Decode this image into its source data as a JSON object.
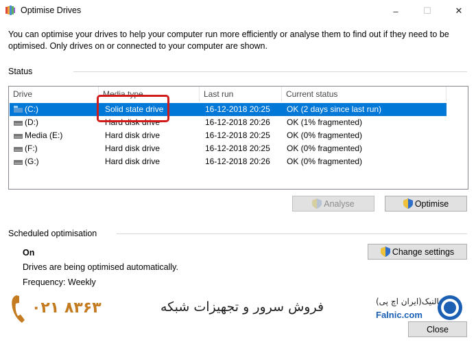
{
  "window": {
    "title": "Optimise Drives",
    "minimize": "–",
    "maximize": "☐",
    "close": "✕"
  },
  "description": "You can optimise your drives to help your computer run more efficiently or analyse them to find out if they need to be optimised. Only drives on or connected to your computer are shown.",
  "status": {
    "label": "Status",
    "columns": [
      "Drive",
      "Media type",
      "Last run",
      "Current status"
    ],
    "rows": [
      {
        "drive": "(C:)",
        "media": "Solid state drive",
        "last_run": "16-12-2018 20:25",
        "status": "OK (2 days since last run)",
        "selected": true
      },
      {
        "drive": "(D:)",
        "media": "Hard disk drive",
        "last_run": "16-12-2018 20:26",
        "status": "OK (1% fragmented)"
      },
      {
        "drive": "Media (E:)",
        "media": "Hard disk drive",
        "last_run": "16-12-2018 20:25",
        "status": "OK (0% fragmented)"
      },
      {
        "drive": "(F:)",
        "media": "Hard disk drive",
        "last_run": "16-12-2018 20:25",
        "status": "OK (0% fragmented)"
      },
      {
        "drive": "(G:)",
        "media": "Hard disk drive",
        "last_run": "16-12-2018 20:26",
        "status": "OK (0% fragmented)"
      }
    ]
  },
  "buttons": {
    "analyse": "Analyse",
    "optimise": "Optimise",
    "change_settings": "Change settings",
    "close": "Close"
  },
  "scheduled": {
    "label": "Scheduled optimisation",
    "state": "On",
    "info": "Drives are being optimised automatically.",
    "frequency": "Frequency: Weekly"
  },
  "watermark": {
    "phone": "۰۲۱ ۸۳۶۳",
    "tagline": "فروش سرور و تجهیزات شبکه",
    "brand_fa": "فالنیک(ایران اچ پی)",
    "brand_url": "Falnic.com"
  },
  "colors": {
    "selection": "#0078d7",
    "highlight_box": "#d11a1a",
    "phone": "#c47a1e",
    "brand": "#1a5fb4"
  }
}
